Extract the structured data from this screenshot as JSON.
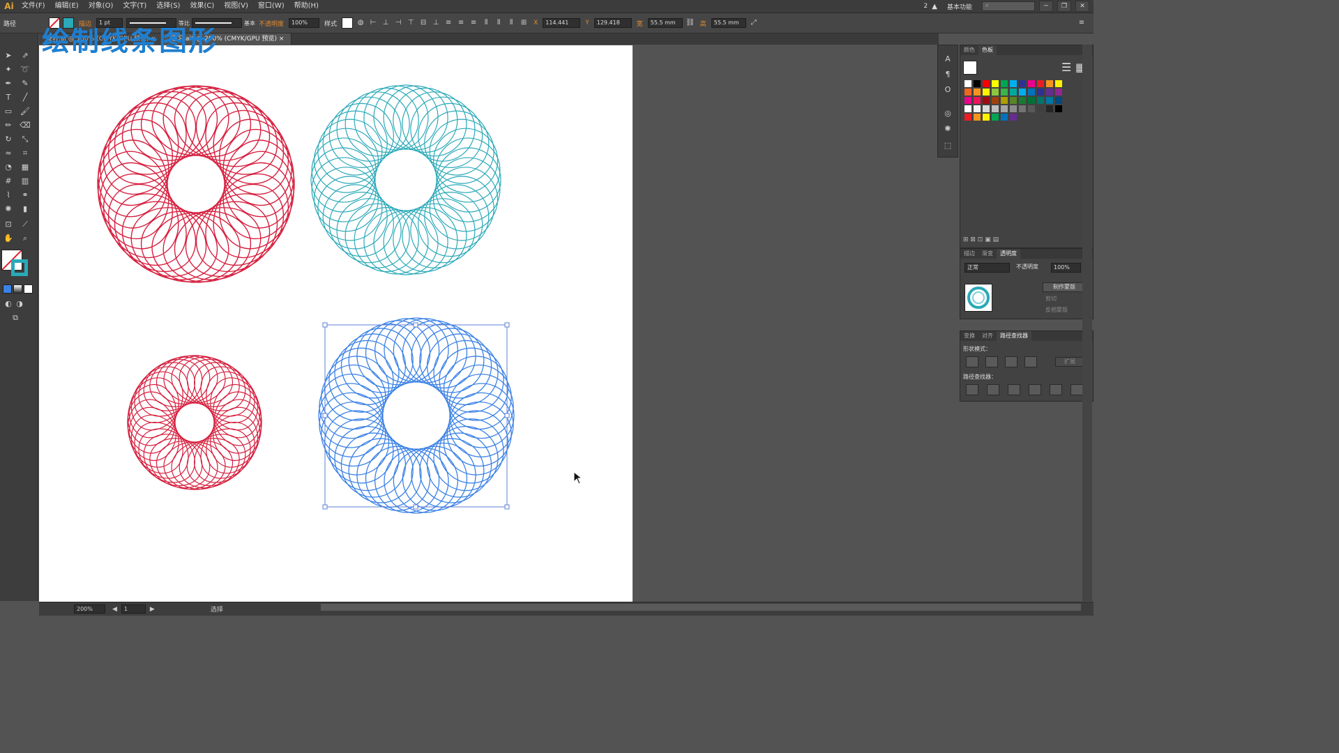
{
  "app": {
    "logo": "Ai",
    "workspace": "基本功能",
    "workspace_num": "2"
  },
  "menu": [
    "文件(F)",
    "编辑(E)",
    "对象(O)",
    "文字(T)",
    "选择(S)",
    "效果(C)",
    "视图(V)",
    "窗口(W)",
    "帮助(H)"
  ],
  "control": {
    "selection_type": "路径",
    "stroke_label": "描边",
    "stroke_weight": "1 pt",
    "stroke_profile": "等比",
    "brush": "基本",
    "opacity_label": "不透明度",
    "opacity_value": "100%",
    "style_label": "样式",
    "x_label": "X",
    "x_value": "114.441",
    "y_label": "Y",
    "y_value": "129.418",
    "w_label": "宽",
    "w_value": "55.5 mm",
    "h_label": "高",
    "h_value": "55.5 mm"
  },
  "tabs": [
    {
      "label": "旋转.ai @ 150% (CMYK/GPU 预览)",
      "active": false
    },
    {
      "label": "练习.ai* @ 200% (CMYK/GPU 预览)",
      "active": true
    }
  ],
  "canvas": {
    "title_text": "绘制线条图形"
  },
  "swatches_tabs": [
    "颜色",
    "色板"
  ],
  "transparency": {
    "tabs": [
      "描边",
      "渐变",
      "透明度"
    ],
    "blend_mode": "正常",
    "opacity_label": "不透明度",
    "opacity_value": "100%",
    "make_mask": "制作蒙版",
    "clip": "剪切",
    "invert_mask": "反相蒙版"
  },
  "pathfinder": {
    "tabs": [
      "变换",
      "对齐",
      "路径查找器"
    ],
    "shape_modes_label": "形状模式：",
    "expand": "扩展",
    "pathfinders_label": "路径查找器："
  },
  "status": {
    "zoom": "200%",
    "page": "1",
    "tool_text": "选择"
  },
  "colors": {
    "red_spiro": "#d6203f",
    "teal_spiro": "#2aa9b8",
    "blue_spiro": "#3b82e6",
    "selection": "#5b7fd6",
    "title": "#1e7fd1"
  }
}
